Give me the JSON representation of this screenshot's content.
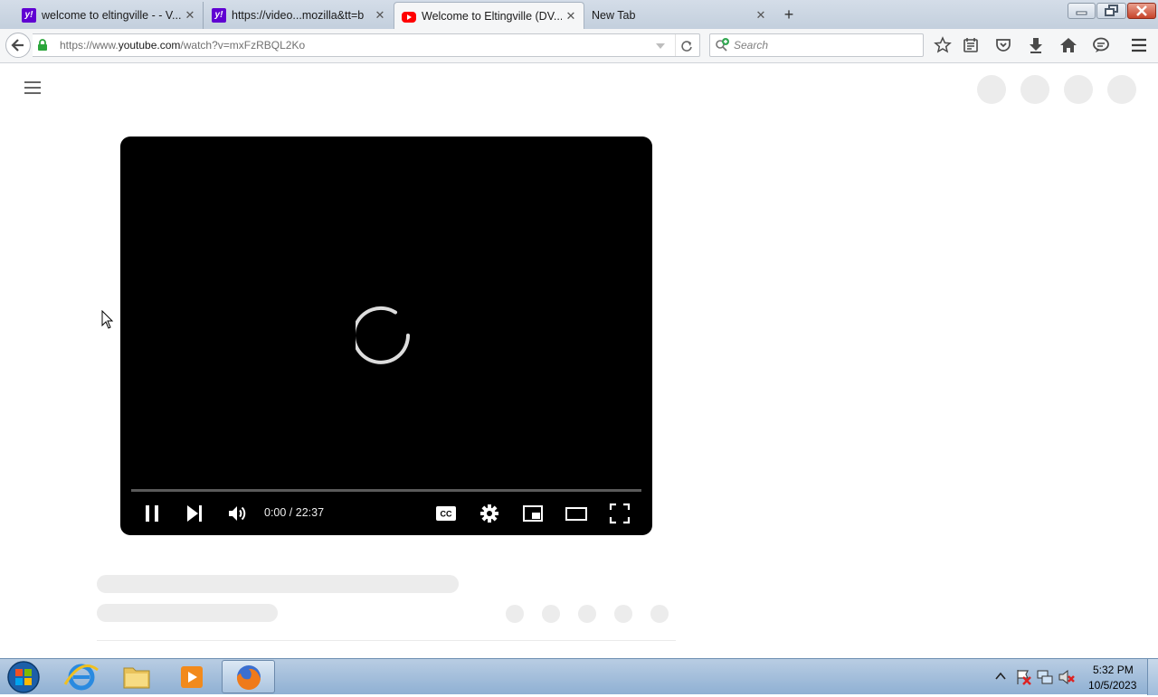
{
  "browser": {
    "tabs": [
      {
        "title": "welcome to eltingville - - V...",
        "favicon": "yahoo-icon",
        "active": false
      },
      {
        "title": "https://video...mozilla&tt=b",
        "favicon": "yahoo-icon",
        "active": false
      },
      {
        "title": "Welcome to Eltingville (DV...",
        "favicon": "youtube-icon",
        "active": true
      },
      {
        "title": "New Tab",
        "favicon": "",
        "active": false
      }
    ],
    "yahoo_glyph": "y!",
    "close_glyph": "✕",
    "new_tab_glyph": "+",
    "url_prefix": "https://www.",
    "url_domain": "youtube.com",
    "url_path": "/watch?v=mxFzRBQL2Ko",
    "search_placeholder": "Search"
  },
  "player": {
    "time_display": "0:00 / 22:37",
    "progress_fraction": 0.0,
    "state": "loading",
    "colors": {
      "progress": "#ff0000",
      "track": "#5a5a5a",
      "background": "#000000"
    }
  },
  "taskbar": {
    "time": "5:32 PM",
    "date": "10/5/2023",
    "apps": [
      "start-orb-icon",
      "internet-explorer-icon",
      "file-explorer-icon",
      "media-player-icon",
      "firefox-icon"
    ]
  },
  "colors": {
    "accent": "#ff0000",
    "yahoo": "#6001d2",
    "skeleton": "#ececec"
  }
}
